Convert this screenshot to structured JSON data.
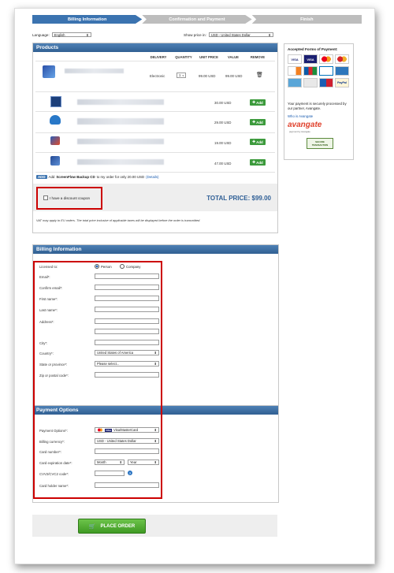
{
  "steps": [
    "Billing Information",
    "Confirmation and Payment",
    "Finish"
  ],
  "language": {
    "label": "Language:",
    "value": "English"
  },
  "price_in": {
    "label": "Show price in:",
    "value": "USD - United States Dollar"
  },
  "products": {
    "title": "Products",
    "columns": [
      "DELIVERY",
      "QUANTITY",
      "UNIT PRICE",
      "VALUE",
      "REMOVE"
    ],
    "main": {
      "delivery": "Electronic",
      "quantity": "1",
      "unit_price": "99.00 USD",
      "value": "99.00 USD"
    },
    "addons": [
      {
        "price": "30.00 USD",
        "button": "Add"
      },
      {
        "price": "29.00 USD",
        "button": "Add"
      },
      {
        "price": "19.00 USD",
        "button": "Add"
      },
      {
        "price": "47.00 USD",
        "button": "Add"
      }
    ],
    "backup_cd": {
      "badge": "ADD",
      "text_pre": "Add ",
      "text_bold": "ScreenFlow Backup CD",
      "text_post": " to my order for only 20.00 USD ",
      "link": "(Details)"
    },
    "coupon": "I have a discount coupon",
    "total": "TOTAL PRICE: $99.00",
    "vat_note": "VAT may apply to EU orders. The total price inclusive of applicable taxes will be displayed before the order is transmitted."
  },
  "payment_sidebar": {
    "title": "Accepted Forms of Payment:",
    "methods": [
      "VISA",
      "VISA",
      "MC",
      "MC",
      "DISC",
      "JCB",
      "DINERS",
      "AMEX",
      "AMEX",
      "BANK",
      "MAESTRO",
      "PayPal"
    ],
    "secure_text": "Your payment is securely processed by our partner, Avangate.",
    "link": "Who is Avangate",
    "brand": "avangate",
    "brand_sub": "payment by Avangate",
    "seal": "SECURE TRANSACTION"
  },
  "billing": {
    "title": "Billing Information",
    "licensed_to": "Licensed to:",
    "option_person": "Person",
    "option_company": "Company",
    "fields": [
      "Email*:",
      "Confirm email*:",
      "First name*:",
      "Last name*:",
      "Address*:",
      "City*:",
      "Country*:",
      "State or province*:",
      "Zip or postal code*:"
    ],
    "country_value": "United States of America",
    "state_value": "Please select..."
  },
  "payment": {
    "title": "Payment Options",
    "fields": [
      "Payment Options*:",
      "Billing currency*:",
      "Card number*:",
      "Card expiration date*:",
      "CVV2/CVC2 code*:",
      "Card holder name*:"
    ],
    "method_value": "Visa/MasterCard",
    "currency_value": "USD - United States Dollar",
    "month": "Month",
    "year": "Year"
  },
  "place_order": "PLACE ORDER"
}
